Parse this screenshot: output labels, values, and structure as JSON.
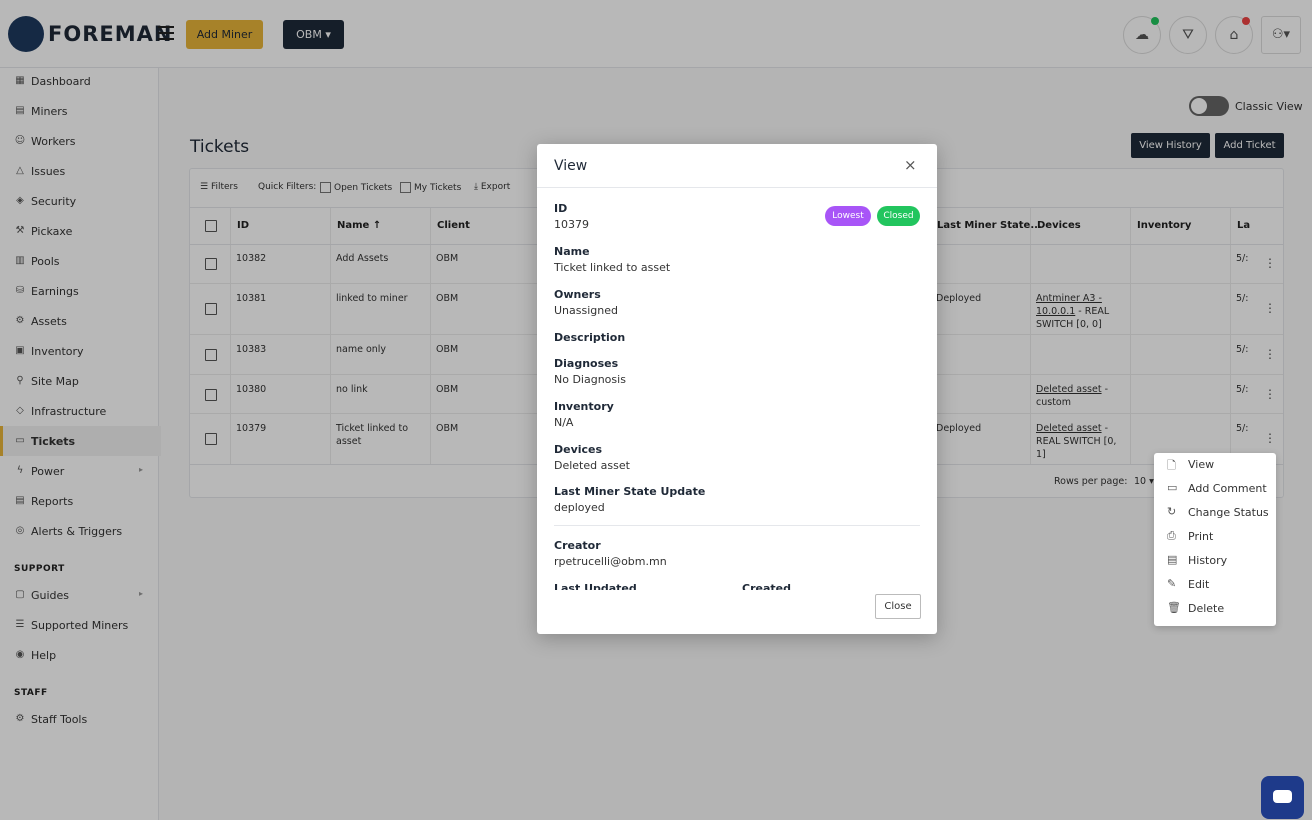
{
  "header": {
    "brand": "FOREMAN",
    "add_miner": "Add Miner",
    "org_select": "OBM ▾",
    "icons": [
      "cloud-upload-icon",
      "filter-icon",
      "graduation-cap-icon",
      "user-menu-icon"
    ]
  },
  "sidebar": {
    "items": [
      {
        "label": "Dashboard",
        "icon": "▦"
      },
      {
        "label": "Miners",
        "icon": "▤"
      },
      {
        "label": "Workers",
        "icon": "☺"
      },
      {
        "label": "Issues",
        "icon": "△"
      },
      {
        "label": "Security",
        "icon": "◈"
      },
      {
        "label": "Pickaxe",
        "icon": "⚒"
      },
      {
        "label": "Pools",
        "icon": "▥"
      },
      {
        "label": "Earnings",
        "icon": "⛁"
      },
      {
        "label": "Assets",
        "icon": "⚙"
      },
      {
        "label": "Inventory",
        "icon": "▣"
      },
      {
        "label": "Site Map",
        "icon": "⚲"
      },
      {
        "label": "Infrastructure",
        "icon": "◇"
      },
      {
        "label": "Tickets",
        "icon": "▭"
      },
      {
        "label": "Power",
        "icon": "ϟ"
      },
      {
        "label": "Reports",
        "icon": "▤"
      },
      {
        "label": "Alerts & Triggers",
        "icon": "◎"
      }
    ],
    "support_title": "SUPPORT",
    "support_items": [
      {
        "label": "Guides",
        "icon": "▢"
      },
      {
        "label": "Supported Miners",
        "icon": "☰"
      },
      {
        "label": "Help",
        "icon": "◉"
      }
    ],
    "staff_title": "STAFF",
    "staff_items": [
      {
        "label": "Staff Tools",
        "icon": "⚙"
      }
    ]
  },
  "page": {
    "classic_view": "Classic View",
    "title": "Tickets",
    "view_history": "View History",
    "add_ticket": "Add Ticket"
  },
  "grid": {
    "toolbar": {
      "filters": "Filters",
      "quick_filters": "Quick Filters:",
      "open_tickets": "Open Tickets",
      "my_tickets": "My Tickets",
      "export": "Export"
    },
    "columns": [
      "ID",
      "Name",
      "Client",
      "Last Miner State...",
      "Devices",
      "Inventory",
      "La"
    ],
    "rows": [
      {
        "id": "10382",
        "name": "Add Assets",
        "client": "OBM",
        "state": "",
        "device_link": "",
        "device_rest": "",
        "date": "5/:"
      },
      {
        "id": "10381",
        "name": "linked to miner",
        "client": "OBM",
        "state": "Deployed",
        "device_link": "Antminer A3 - 10.0.0.1",
        "device_rest": " - REAL SWITCH [0, 0]",
        "date": "5/:"
      },
      {
        "id": "10383",
        "name": "name only",
        "client": "OBM",
        "state": "",
        "device_link": "",
        "device_rest": "",
        "date": "5/:"
      },
      {
        "id": "10380",
        "name": "no link",
        "client": "OBM",
        "state": "",
        "device_link": "Deleted asset",
        "device_rest": " - custom",
        "date": "5/:"
      },
      {
        "id": "10379",
        "name": "Ticket linked to asset",
        "client": "OBM",
        "state": "Deployed",
        "device_link": "Deleted asset",
        "device_rest": " - REAL SWITCH [0, 1]",
        "date": "5/:"
      }
    ],
    "rows_per_page_label": "Rows per page:",
    "rows_per_page_value": "10 ▾"
  },
  "context_menu": {
    "items": [
      {
        "label": "View",
        "icon": "🗋"
      },
      {
        "label": "Add Comment",
        "icon": "▭"
      },
      {
        "label": "Change Status",
        "icon": "↻"
      },
      {
        "label": "Print",
        "icon": "⎙"
      },
      {
        "label": "History",
        "icon": "▤"
      },
      {
        "label": "Edit",
        "icon": "✎"
      },
      {
        "label": "Delete",
        "icon": "🗑"
      }
    ]
  },
  "modal": {
    "title": "View",
    "close_x": "×",
    "badges": [
      {
        "label": "Lowest",
        "color": "#a855f7"
      },
      {
        "label": "Closed",
        "color": "#22c55e"
      }
    ],
    "fields": [
      {
        "label": "ID",
        "value": "10379"
      },
      {
        "label": "Name",
        "value": "Ticket linked to asset"
      },
      {
        "label": "Owners",
        "value": "Unassigned"
      },
      {
        "label": "Description",
        "value": ""
      },
      {
        "label": "Diagnoses",
        "value": "No Diagnosis"
      },
      {
        "label": "Inventory",
        "value": "N/A"
      },
      {
        "label": "Devices",
        "value": "Deleted asset"
      },
      {
        "label": "Last Miner State Update",
        "value": "deployed"
      }
    ],
    "creator_label": "Creator",
    "creator_value": "rpetrucelli@obm.mn",
    "last_updated_label": "Last Updated",
    "created_label": "Created",
    "close_button": "Close"
  },
  "colors": {
    "accent": "#e8b53a",
    "dark": "#1e2a3a",
    "chat": "#1e3a8a"
  }
}
